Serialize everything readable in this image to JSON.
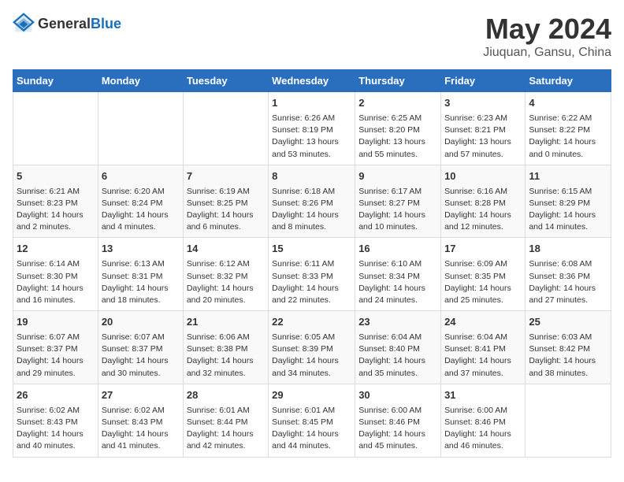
{
  "header": {
    "logo_general": "General",
    "logo_blue": "Blue",
    "title": "May 2024",
    "subtitle": "Jiuquan, Gansu, China"
  },
  "weekdays": [
    "Sunday",
    "Monday",
    "Tuesday",
    "Wednesday",
    "Thursday",
    "Friday",
    "Saturday"
  ],
  "weeks": [
    [
      {
        "day": "",
        "info": ""
      },
      {
        "day": "",
        "info": ""
      },
      {
        "day": "",
        "info": ""
      },
      {
        "day": "1",
        "info": "Sunrise: 6:26 AM\nSunset: 8:19 PM\nDaylight: 13 hours\nand 53 minutes."
      },
      {
        "day": "2",
        "info": "Sunrise: 6:25 AM\nSunset: 8:20 PM\nDaylight: 13 hours\nand 55 minutes."
      },
      {
        "day": "3",
        "info": "Sunrise: 6:23 AM\nSunset: 8:21 PM\nDaylight: 13 hours\nand 57 minutes."
      },
      {
        "day": "4",
        "info": "Sunrise: 6:22 AM\nSunset: 8:22 PM\nDaylight: 14 hours\nand 0 minutes."
      }
    ],
    [
      {
        "day": "5",
        "info": "Sunrise: 6:21 AM\nSunset: 8:23 PM\nDaylight: 14 hours\nand 2 minutes."
      },
      {
        "day": "6",
        "info": "Sunrise: 6:20 AM\nSunset: 8:24 PM\nDaylight: 14 hours\nand 4 minutes."
      },
      {
        "day": "7",
        "info": "Sunrise: 6:19 AM\nSunset: 8:25 PM\nDaylight: 14 hours\nand 6 minutes."
      },
      {
        "day": "8",
        "info": "Sunrise: 6:18 AM\nSunset: 8:26 PM\nDaylight: 14 hours\nand 8 minutes."
      },
      {
        "day": "9",
        "info": "Sunrise: 6:17 AM\nSunset: 8:27 PM\nDaylight: 14 hours\nand 10 minutes."
      },
      {
        "day": "10",
        "info": "Sunrise: 6:16 AM\nSunset: 8:28 PM\nDaylight: 14 hours\nand 12 minutes."
      },
      {
        "day": "11",
        "info": "Sunrise: 6:15 AM\nSunset: 8:29 PM\nDaylight: 14 hours\nand 14 minutes."
      }
    ],
    [
      {
        "day": "12",
        "info": "Sunrise: 6:14 AM\nSunset: 8:30 PM\nDaylight: 14 hours\nand 16 minutes."
      },
      {
        "day": "13",
        "info": "Sunrise: 6:13 AM\nSunset: 8:31 PM\nDaylight: 14 hours\nand 18 minutes."
      },
      {
        "day": "14",
        "info": "Sunrise: 6:12 AM\nSunset: 8:32 PM\nDaylight: 14 hours\nand 20 minutes."
      },
      {
        "day": "15",
        "info": "Sunrise: 6:11 AM\nSunset: 8:33 PM\nDaylight: 14 hours\nand 22 minutes."
      },
      {
        "day": "16",
        "info": "Sunrise: 6:10 AM\nSunset: 8:34 PM\nDaylight: 14 hours\nand 24 minutes."
      },
      {
        "day": "17",
        "info": "Sunrise: 6:09 AM\nSunset: 8:35 PM\nDaylight: 14 hours\nand 25 minutes."
      },
      {
        "day": "18",
        "info": "Sunrise: 6:08 AM\nSunset: 8:36 PM\nDaylight: 14 hours\nand 27 minutes."
      }
    ],
    [
      {
        "day": "19",
        "info": "Sunrise: 6:07 AM\nSunset: 8:37 PM\nDaylight: 14 hours\nand 29 minutes."
      },
      {
        "day": "20",
        "info": "Sunrise: 6:07 AM\nSunset: 8:37 PM\nDaylight: 14 hours\nand 30 minutes."
      },
      {
        "day": "21",
        "info": "Sunrise: 6:06 AM\nSunset: 8:38 PM\nDaylight: 14 hours\nand 32 minutes."
      },
      {
        "day": "22",
        "info": "Sunrise: 6:05 AM\nSunset: 8:39 PM\nDaylight: 14 hours\nand 34 minutes."
      },
      {
        "day": "23",
        "info": "Sunrise: 6:04 AM\nSunset: 8:40 PM\nDaylight: 14 hours\nand 35 minutes."
      },
      {
        "day": "24",
        "info": "Sunrise: 6:04 AM\nSunset: 8:41 PM\nDaylight: 14 hours\nand 37 minutes."
      },
      {
        "day": "25",
        "info": "Sunrise: 6:03 AM\nSunset: 8:42 PM\nDaylight: 14 hours\nand 38 minutes."
      }
    ],
    [
      {
        "day": "26",
        "info": "Sunrise: 6:02 AM\nSunset: 8:43 PM\nDaylight: 14 hours\nand 40 minutes."
      },
      {
        "day": "27",
        "info": "Sunrise: 6:02 AM\nSunset: 8:43 PM\nDaylight: 14 hours\nand 41 minutes."
      },
      {
        "day": "28",
        "info": "Sunrise: 6:01 AM\nSunset: 8:44 PM\nDaylight: 14 hours\nand 42 minutes."
      },
      {
        "day": "29",
        "info": "Sunrise: 6:01 AM\nSunset: 8:45 PM\nDaylight: 14 hours\nand 44 minutes."
      },
      {
        "day": "30",
        "info": "Sunrise: 6:00 AM\nSunset: 8:46 PM\nDaylight: 14 hours\nand 45 minutes."
      },
      {
        "day": "31",
        "info": "Sunrise: 6:00 AM\nSunset: 8:46 PM\nDaylight: 14 hours\nand 46 minutes."
      },
      {
        "day": "",
        "info": ""
      }
    ]
  ]
}
